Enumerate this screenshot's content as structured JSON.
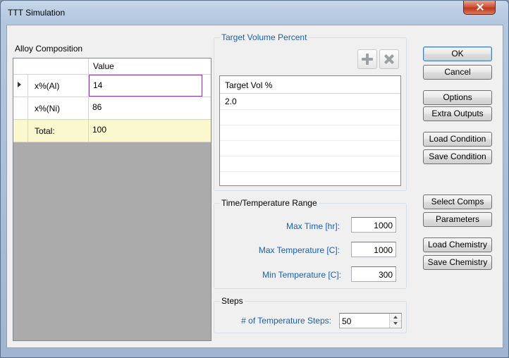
{
  "window": {
    "title": "TTT Simulation"
  },
  "alloy": {
    "label": "Alloy Composition",
    "value_header": "Value",
    "rows": [
      {
        "name": "x%(Al)",
        "value": "14"
      },
      {
        "name": "x%(Ni)",
        "value": "86"
      }
    ],
    "total": {
      "name": "Total:",
      "value": "100"
    }
  },
  "target": {
    "title": "Target Volume Percent",
    "list_header": "Target Vol %",
    "items": [
      "2.0"
    ]
  },
  "range": {
    "title": "Time/Temperature Range",
    "max_time_label": "Max Time [hr]:",
    "max_time": "1000",
    "max_temp_label": "Max Temperature [C]:",
    "max_temp": "1000",
    "min_temp_label": "Min Temperature [C]:",
    "min_temp": "300"
  },
  "steps": {
    "title": "Steps",
    "count_label": "# of Temperature Steps:",
    "count": "50"
  },
  "buttons": {
    "ok": "OK",
    "cancel": "Cancel",
    "options": "Options",
    "extra_outputs": "Extra Outputs",
    "load_condition": "Load Condition",
    "save_condition": "Save Condition",
    "select_comps": "Select Comps",
    "parameters": "Parameters",
    "load_chemistry": "Load Chemistry",
    "save_chemistry": "Save Chemistry"
  },
  "icons": {
    "add": "plus-icon",
    "remove": "x-icon",
    "close": "close-icon"
  },
  "colors": {
    "accent_text": "#1a5fb4",
    "total_row": "#fbf8cf",
    "selected_cell_border": "#8a3aa0"
  }
}
